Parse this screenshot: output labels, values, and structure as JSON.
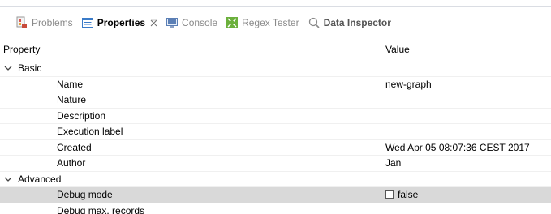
{
  "tabs": [
    {
      "label": "Problems",
      "icon": "problems-icon",
      "active": false
    },
    {
      "label": "Properties",
      "icon": "properties-icon",
      "active": true,
      "closable": true
    },
    {
      "label": "Console",
      "icon": "console-icon",
      "active": false
    },
    {
      "label": "Regex Tester",
      "icon": "regex-tester-icon",
      "active": false
    },
    {
      "label": "Data Inspector",
      "icon": "search-icon",
      "active": false
    }
  ],
  "table": {
    "headers": {
      "property": "Property",
      "value": "Value"
    },
    "groups": [
      {
        "label": "Basic",
        "rows": [
          {
            "property": "Name",
            "value": "new-graph"
          },
          {
            "property": "Nature",
            "value": ""
          },
          {
            "property": "Description",
            "value": ""
          },
          {
            "property": "Execution label",
            "value": ""
          },
          {
            "property": "Created",
            "value": "Wed Apr 05 08:07:36 CEST 2017"
          },
          {
            "property": "Author",
            "value": "Jan"
          }
        ]
      },
      {
        "label": "Advanced",
        "rows": [
          {
            "property": "Debug mode",
            "value": "false",
            "checkbox": true,
            "checked": false,
            "selected": true
          },
          {
            "property": "Debug max. records",
            "value": ""
          }
        ]
      }
    ]
  },
  "colors": {
    "selected_row": "#d9d9d9",
    "tab_inactive_text": "#8a8a8a",
    "properties_icon": "#3a7bc8",
    "console_icon": "#5b7fb5",
    "regex_icon": "#6bb03c",
    "problems_icon": "#c84a3a"
  }
}
